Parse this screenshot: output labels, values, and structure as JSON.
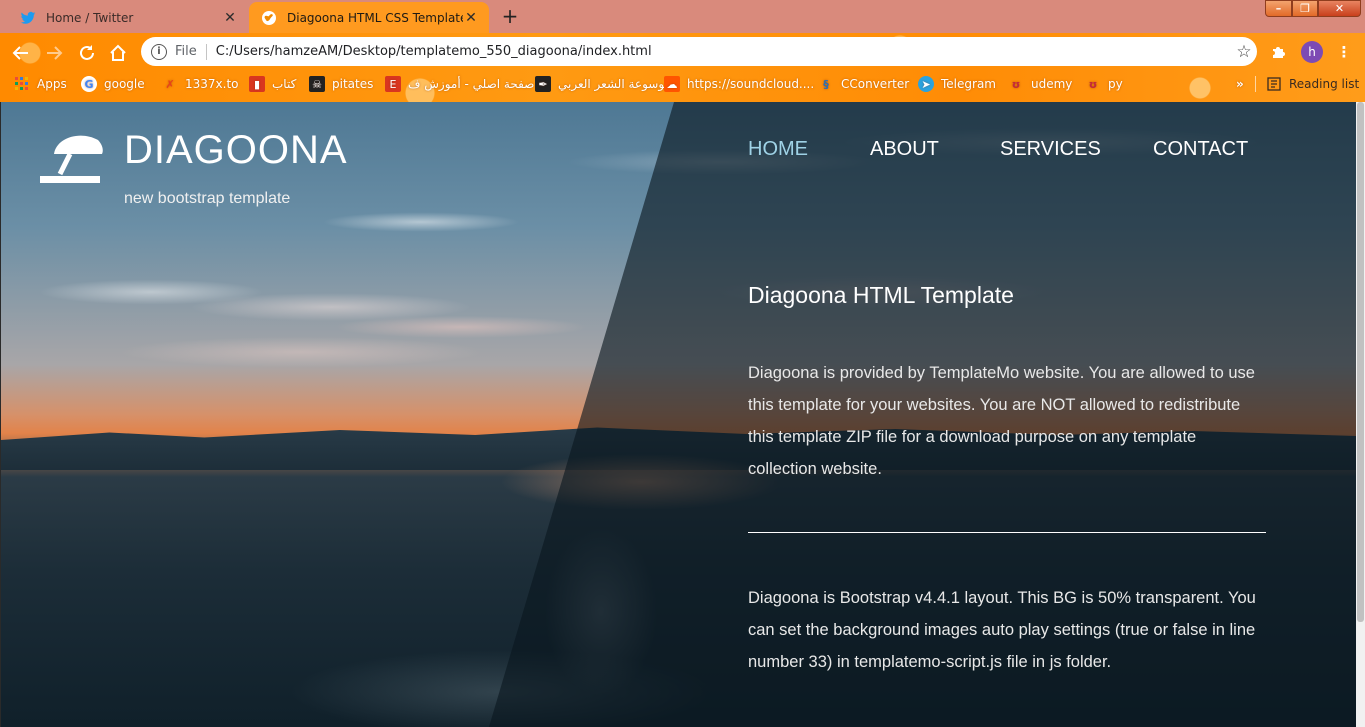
{
  "browser": {
    "tabs": [
      {
        "title": "Home / Twitter",
        "icon": "twitter-icon",
        "active": false
      },
      {
        "title": "Diagoona HTML CSS Template",
        "icon": "globe-icon",
        "active": true
      }
    ],
    "new_tab": "+",
    "address": {
      "scheme_label": "File",
      "url": "C:/Users/hamzeAM/Desktop/templatemo_550_diagoona/index.html"
    },
    "profile_initial": "h",
    "bookmarks": [
      {
        "label": "Apps",
        "icon": "apps-grid-icon"
      },
      {
        "label": "google",
        "icon": "google-icon"
      },
      {
        "label": "1337x.to",
        "icon": "1337x-icon"
      },
      {
        "label": "كتاب",
        "icon": "book-icon"
      },
      {
        "label": "pitates",
        "icon": "pirate-icon"
      },
      {
        "label": "صفحة اصلي - أموزش ف...",
        "icon": "e-icon"
      },
      {
        "label": "موسوعة الشعر العربي",
        "icon": "quill-icon"
      },
      {
        "label": "https://soundcloud....",
        "icon": "soundcloud-icon"
      },
      {
        "label": "CConverter",
        "icon": "converter-icon"
      },
      {
        "label": "Telegram",
        "icon": "telegram-icon"
      },
      {
        "label": "udemy",
        "icon": "udemy-icon"
      },
      {
        "label": "py",
        "icon": "udemy-icon"
      }
    ],
    "more_bookmarks": "»",
    "reading_list": "Reading list"
  },
  "site": {
    "brand_name": "DIAGOONA",
    "tagline": "new bootstrap template",
    "nav": [
      "HOME",
      "ABOUT",
      "SERVICES",
      "CONTACT"
    ],
    "active_nav": "HOME",
    "heading": "Diagoona HTML Template",
    "paragraph1": "Diagoona is provided by TemplateMo website. You are allowed to use this template for your websites. You are NOT allowed to redistribute this template ZIP file for a download purpose on any template collection website.",
    "paragraph2": "Diagoona is Bootstrap v4.4.1 layout. This BG is 50% transparent. You can set the background images auto play settings (true or false in line number 33) in templatemo-script.js file in js folder."
  },
  "colors": {
    "tabbar": "#d98a7c",
    "toolbar": "#ff8a00",
    "nav_active": "#9fd2e6"
  }
}
